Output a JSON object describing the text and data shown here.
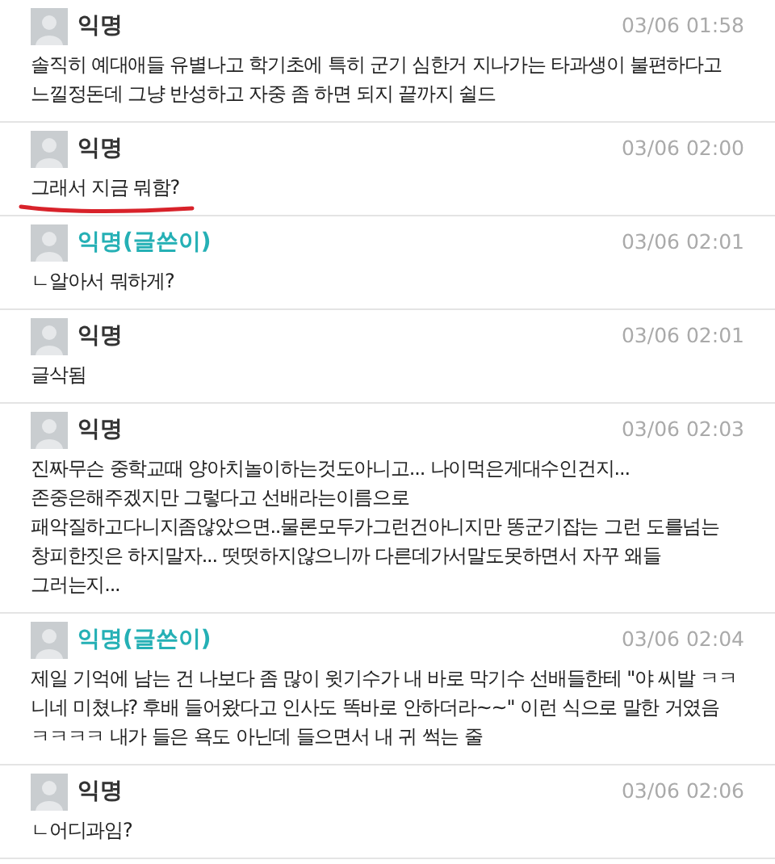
{
  "comments": [
    {
      "author": "익명",
      "is_writer": false,
      "time": "03/06 01:58",
      "lines": [
        "솔직히 예대애들 유별나고 학기초에 특히 군기 심한거 지나가는 타과생이 불편하다고",
        "느낄정돈데 그냥 반성하고 자중 좀 하면 되지 끝까지 쉴드"
      ],
      "underlined": false
    },
    {
      "author": "익명",
      "is_writer": false,
      "time": "03/06 02:00",
      "lines": [
        "그래서 지금 뭐함?"
      ],
      "underlined": true
    },
    {
      "author": "익명(글쓴이)",
      "is_writer": true,
      "time": "03/06 02:01",
      "lines": [
        "ㄴ알아서 뭐하게?"
      ],
      "underlined": false
    },
    {
      "author": "익명",
      "is_writer": false,
      "time": "03/06 02:01",
      "lines": [
        "글삭됨"
      ],
      "underlined": false
    },
    {
      "author": "익명",
      "is_writer": false,
      "time": "03/06 02:03",
      "lines": [
        "진짜무슨 중학교때 양아치놀이하는것도아니고... 나이먹은게대수인건지...",
        "존중은해주겠지만 그렇다고 선배라는이름으로",
        "패악질하고다니지좀않았으면..물론모두가그런건아니지만 똥군기잡는 그런 도를넘는",
        "창피한짓은 하지말자... 떳떳하지않으니까 다른데가서말도못하면서 자꾸 왜들",
        "그러는지..."
      ],
      "underlined": false
    },
    {
      "author": "익명(글쓴이)",
      "is_writer": true,
      "time": "03/06 02:04",
      "lines": [
        "제일 기억에 남는 건 나보다 좀 많이 윗기수가 내 바로 막기수 선배들한테 \"야 씨발 ㅋㅋ",
        "니네 미쳤냐? 후배 들어왔다고 인사도 똑바로 안하더라~~\" 이런 식으로 말한 거였음",
        "ㅋㅋㅋㅋ 내가 들은 욕도 아닌데 들으면서 내 귀 썩는 줄"
      ],
      "underlined": false
    },
    {
      "author": "익명",
      "is_writer": false,
      "time": "03/06 02:06",
      "lines": [
        "ㄴ어디과임?"
      ],
      "underlined": false
    }
  ]
}
